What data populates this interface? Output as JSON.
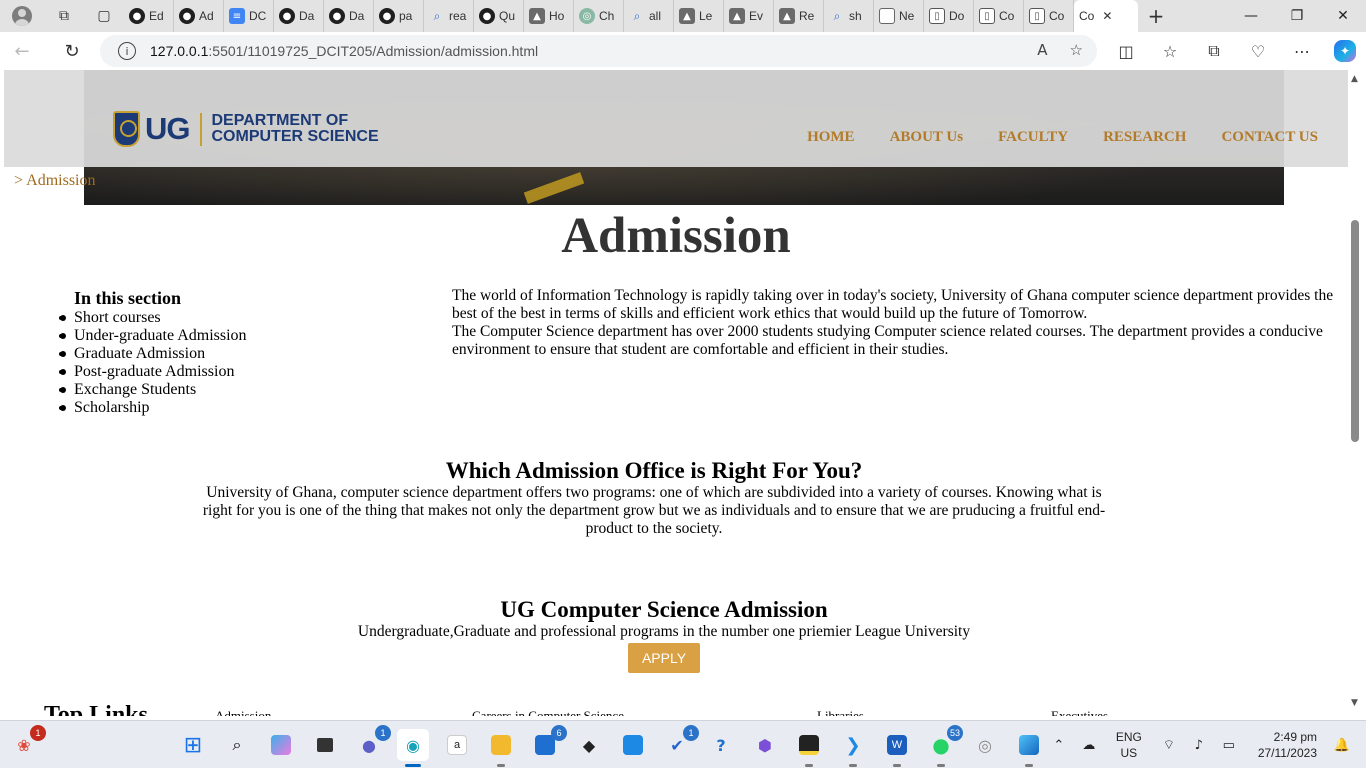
{
  "browser": {
    "tabs": [
      {
        "icon": "github-icon",
        "title": "Ed"
      },
      {
        "icon": "github-icon",
        "title": "Ad"
      },
      {
        "icon": "document-icon",
        "title": "DC"
      },
      {
        "icon": "github-icon",
        "title": "Da"
      },
      {
        "icon": "github-icon",
        "title": "Da"
      },
      {
        "icon": "github-icon",
        "title": "pa"
      },
      {
        "icon": "search-icon",
        "title": "rea"
      },
      {
        "icon": "github-icon",
        "title": "Qu"
      },
      {
        "icon": "image-icon",
        "title": "Ho"
      },
      {
        "icon": "chat-icon",
        "title": "Ch"
      },
      {
        "icon": "search-icon",
        "title": "all"
      },
      {
        "icon": "image-icon",
        "title": "Le"
      },
      {
        "icon": "image-icon",
        "title": "Ev"
      },
      {
        "icon": "image-icon",
        "title": "Re"
      },
      {
        "icon": "search-icon",
        "title": "sh"
      },
      {
        "icon": "newtab-icon",
        "title": "Ne"
      },
      {
        "icon": "page-icon",
        "title": "Do"
      },
      {
        "icon": "page-icon",
        "title": "Co"
      },
      {
        "icon": "page-icon",
        "title": "Co"
      }
    ],
    "active_tab": {
      "title": "Co"
    },
    "url_host": "127.0.0.1",
    "url_path": ":5501/11019725_DCIT205/Admission/admission.html"
  },
  "header": {
    "logo_text": "UG",
    "dept_line1": "DEPARTMENT OF",
    "dept_line2": "COMPUTER SCIENCE",
    "nav": [
      "HOME",
      "ABOUT Us",
      "FACULTY",
      "RESEARCH",
      "CONTACT US"
    ]
  },
  "breadcrumb": "> Admission",
  "page_title": "Admission",
  "section_nav": {
    "heading": "In this section",
    "items": [
      "Short courses",
      "Under-graduate Admission",
      "Graduate Admission",
      "Post-graduate Admission",
      "Exchange Students",
      "Scholarship"
    ]
  },
  "intro": {
    "p1": "The world of Information Technology is rapidly taking over in today's society, University of Ghana computer science department provides the best of the best in terms of skills and efficient work ethics that would build up the future of Tomorrow.",
    "p2": "The Computer Science department has over 2000 students studying Computer science related courses. The department provides a conducive environment to ensure that student are comfortable and efficient in their studies."
  },
  "office": {
    "heading": "Which Admission Office is Right For You?",
    "text": "University of Ghana, computer science department offers two programs: one of which are subdivided into a variety of courses. Knowing what is right for you is one of the thing that makes not only the department grow but we as individuals and to ensure that we are pruducing a fruitful end-product to the society."
  },
  "ug_admission": {
    "heading": "UG Computer Science Admission",
    "text": "Undergraduate,Graduate and professional programs in the number one priemier League University",
    "button": "APPLY"
  },
  "footer": {
    "heading": "Top Links",
    "links": [
      "Admission",
      "Careers in Computer Science",
      "Libraries",
      "Executives"
    ]
  },
  "taskbar": {
    "badges": {
      "notification": "1",
      "teams": "1",
      "mail": "6",
      "todo": "1",
      "whatsapp": "53"
    },
    "lang_line1": "ENG",
    "lang_line2": "US",
    "time": "2:49 pm",
    "date": "27/11/2023"
  },
  "colors": {
    "nav_gold": "#b27b2a",
    "brand_blue": "#1c3a76",
    "apply_button": "#d9a044"
  }
}
